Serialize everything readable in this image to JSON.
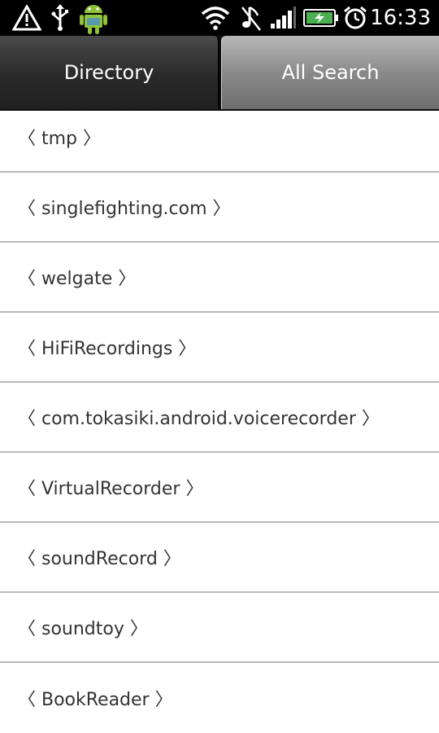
{
  "status_bar": {
    "time": "16:33",
    "icons": [
      "warning-icon",
      "usb-icon",
      "android-icon",
      "wifi-icon",
      "mute-icon",
      "signal-icon",
      "battery-charging-icon",
      "alarm-icon"
    ]
  },
  "tabs": [
    {
      "label": "Directory",
      "selected": true
    },
    {
      "label": "All Search",
      "selected": false
    }
  ],
  "directory_list": {
    "items": [
      {
        "label": "〈 tmp 〉"
      },
      {
        "label": "〈 singlefighting.com 〉"
      },
      {
        "label": "〈 welgate 〉"
      },
      {
        "label": "〈 HiFiRecordings 〉"
      },
      {
        "label": "〈 com.tokasiki.android.voicerecorder 〉"
      },
      {
        "label": "〈 VirtualRecorder 〉"
      },
      {
        "label": "〈 soundRecord 〉"
      },
      {
        "label": "〈 soundtoy 〉"
      },
      {
        "label": "〈 BookReader 〉"
      }
    ]
  },
  "colors": {
    "status_bar_bg": "#000000",
    "android_green": "#8fc43a",
    "battery_green": "#4caf50"
  }
}
